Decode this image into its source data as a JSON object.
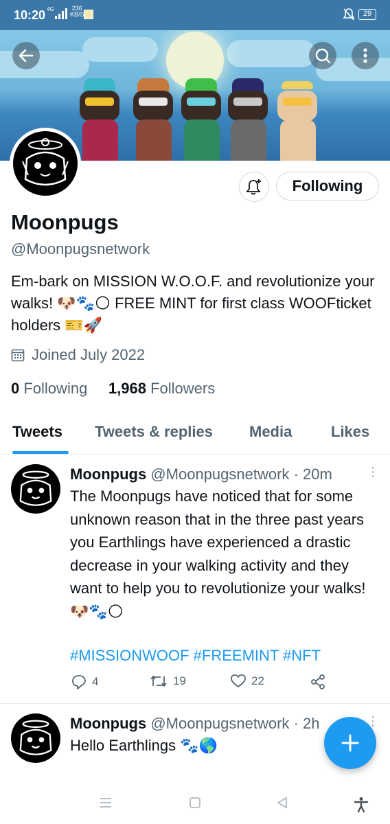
{
  "status_bar": {
    "time": "10:20",
    "network": "4G",
    "speed_value": "236",
    "speed_unit": "KB/S",
    "battery": "29"
  },
  "profile": {
    "name": "Moonpugs",
    "handle": "@Moonpugsnetwork",
    "bio": "Em-bark on MISSION W.O.O.F. and revolutionize your walks! 🐶🐾🌕  FREE MINT for first class WOOFticket holders 🎫🚀",
    "joined": "Joined July 2022",
    "following_count": "0",
    "following_label": "Following",
    "followers_count": "1,968",
    "followers_label": "Followers",
    "follow_button": "Following"
  },
  "tabs": [
    "Tweets",
    "Tweets & replies",
    "Media",
    "Likes"
  ],
  "tweets": [
    {
      "name": "Moonpugs",
      "handle": "@Moonpugsnetwork",
      "time": "· 20m",
      "text": "The Moonpugs have noticed that for some unknown reason that in the three past years you Earthlings have experienced a drastic decrease in your walking activity and they want to help you to revolutionize your walks! 🐶🐾🌕",
      "hashtags": "#MISSIONWOOF #FREEMINT #NFT",
      "replies": "4",
      "retweets": "19",
      "likes": "22"
    },
    {
      "name": "Moonpugs",
      "handle": "@Moonpugsnetwork",
      "time": "· 2h",
      "text": "Hello Earthlings 🐾🌎"
    }
  ],
  "colors": {
    "accent": "#1d9bf0",
    "status_bar": "#3b78a8",
    "secondary_text": "#536471"
  }
}
